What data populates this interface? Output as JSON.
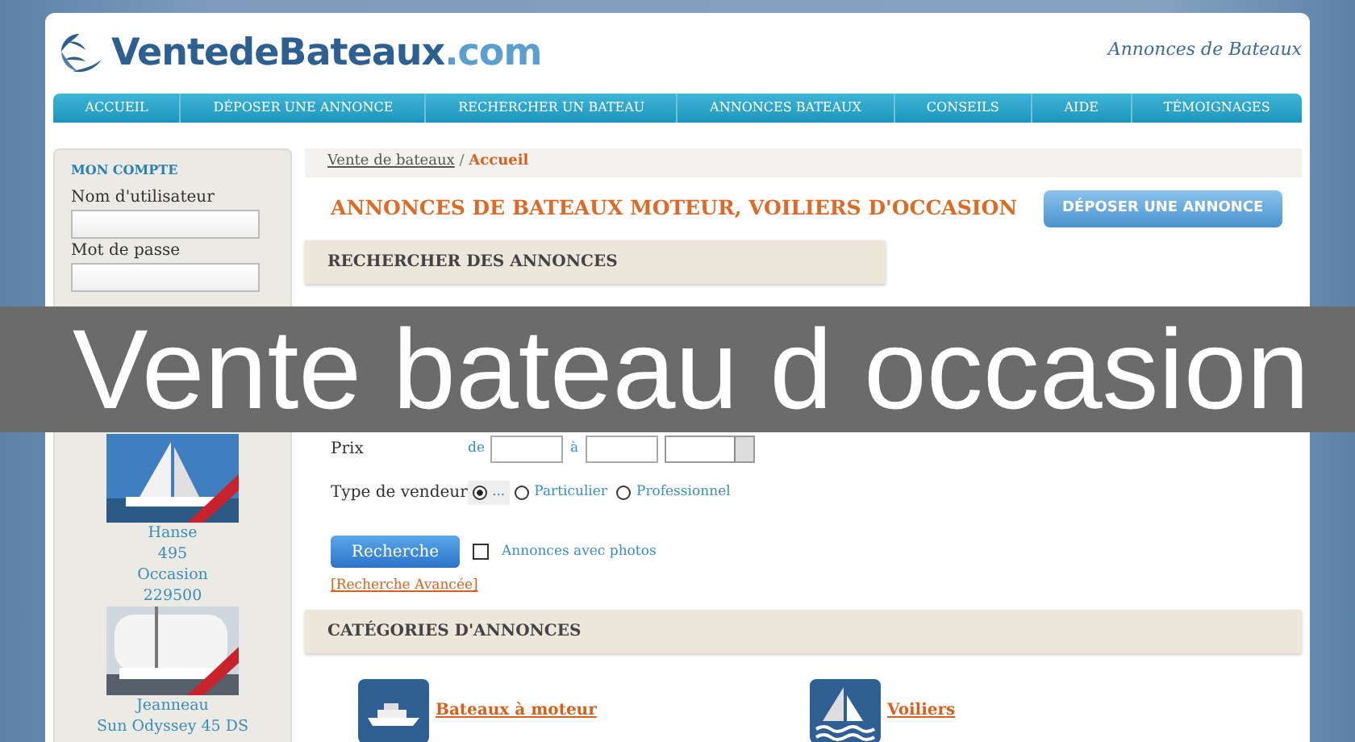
{
  "header": {
    "logo_main": "VentedeBateaux",
    "logo_suffix": ".com",
    "tagline": "Annonces de Bateaux"
  },
  "nav": [
    "ACCUEIL",
    "DÉPOSER UNE ANNONCE",
    "RECHERCHER UN BATEAU",
    "ANNONCES BATEAUX",
    "CONSEILS",
    "AIDE",
    "TÉMOIGNAGES"
  ],
  "sidebar": {
    "account": {
      "title": "MON COMPTE",
      "username_label": "Nom d'utilisateur",
      "password_label": "Mot de passe"
    },
    "recent": {
      "items": [
        {
          "kind": "picture",
          "lines": [
            "Hanse",
            "495",
            "Occasion",
            "229500"
          ]
        },
        {
          "kind": "picture",
          "lines": [
            "Jeanneau",
            "Sun Odyssey 45 DS"
          ]
        }
      ]
    }
  },
  "breadcrumb": {
    "link": "Vente de bateaux",
    "separator": "/",
    "current": "Accueil"
  },
  "heading": "ANNONCES DE BATEAUX MOTEUR, VOILIERS D'OCCASION",
  "deposit_button": "DÉPOSER UNE ANNONCE",
  "search_form": {
    "title": "RECHERCHER DES ANNONCES",
    "fields": [
      {
        "kind": "range",
        "label": "Prix",
        "from_label": "de",
        "to_label": "à"
      },
      {
        "kind": "radios",
        "label": "Type de vendeur",
        "options": [
          {
            "label": "...",
            "selected": true
          },
          {
            "label": "Particulier",
            "selected": false
          },
          {
            "label": "Professionnel",
            "selected": false
          }
        ]
      }
    ],
    "submit": "Recherche",
    "photos_checkbox": {
      "label": "Annonces avec photos",
      "checked": false
    },
    "advanced_link": "[Recherche Avancée]"
  },
  "categories": {
    "title": "CATÉGORIES D'ANNONCES",
    "items": [
      {
        "kind": "motorboat",
        "label": "Bateaux à moteur"
      },
      {
        "kind": "sailboat",
        "label": "Voiliers"
      }
    ]
  },
  "overlay_caption": "Vente bateau d occasion"
}
